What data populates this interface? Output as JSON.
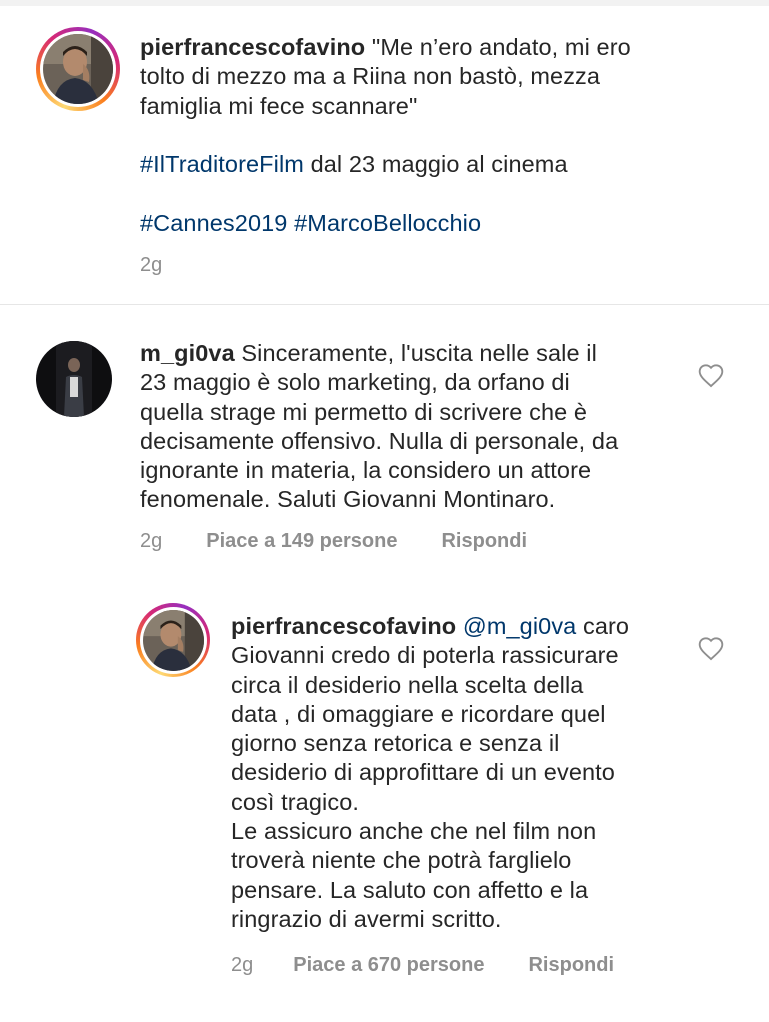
{
  "caption": {
    "username": "pierfrancescofavino",
    "line1": "\"Me n’ero andato, mi ero",
    "line2": "tolto di mezzo ma a Riina non bastò, mezza",
    "line3": "famiglia mi fece scannare\"",
    "hashtag_film": "#IlTraditoreFilm",
    "release_text": " dal 23 maggio al cinema",
    "hashtag_cannes": "#Cannes2019",
    "hashtag_director": "#MarcoBellocchio",
    "time": "2g"
  },
  "comment": {
    "username": "m_gi0va",
    "line1": "Sinceramente, l'uscita nelle sale il",
    "line2": "23 maggio è solo marketing, da orfano di",
    "line3": "quella strage mi permetto di scrivere che è",
    "line4": "decisamente offensivo. Nulla di personale, da",
    "line5": "ignorante in materia, la considero un attore",
    "line6": "fenomenale. Saluti Giovanni Montinaro.",
    "time": "2g",
    "likes": "Piace a 149 persone",
    "reply": "Rispondi",
    "heart_icon": "heart-outline-icon"
  },
  "reply": {
    "username": "pierfrancescofavino",
    "mention": "@m_gi0va",
    "line1_rest": " caro",
    "line2": "Giovanni credo di poterla rassicurare",
    "line3": "circa il desiderio nella scelta della",
    "line4": "data , di omaggiare e ricordare quel",
    "line5": "giorno senza retorica e senza il",
    "line6": "desiderio di approfittare di un evento",
    "line7": "così tragico.",
    "line8": "Le assicuro anche che nel film non",
    "line9": "troverà niente che potrà farglielo",
    "line10": "pensare. La saluto con affetto e la",
    "line11": "ringrazio di avermi scritto.",
    "time": "2g",
    "likes": "Piace a 670 persone",
    "reply": "Rispondi",
    "heart_icon": "heart-outline-icon"
  },
  "colors": {
    "text": "#262626",
    "hashtag": "#00376b",
    "meta": "#8e8e8e",
    "divider": "#e6e6e6"
  }
}
